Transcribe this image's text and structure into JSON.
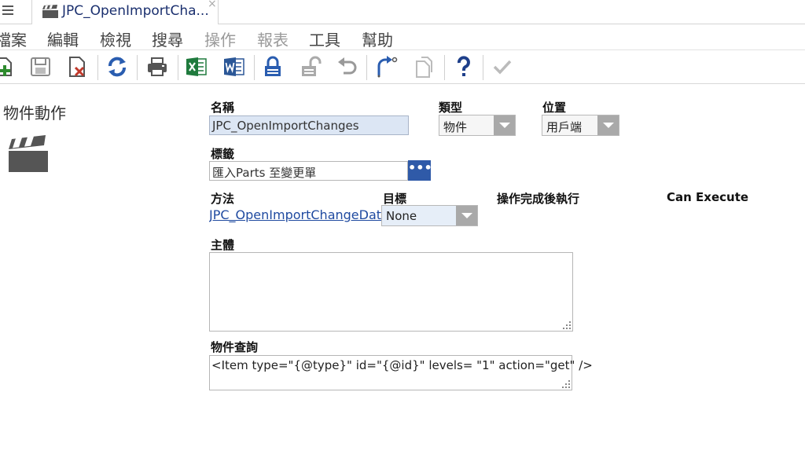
{
  "tab": {
    "title": "JPC_OpenImportCha...",
    "close_glyph": "×",
    "icon": "clapperboard-icon"
  },
  "menu": [
    {
      "label": "檔案",
      "enabled": true
    },
    {
      "label": "編輯",
      "enabled": true
    },
    {
      "label": "檢視",
      "enabled": true
    },
    {
      "label": "搜尋",
      "enabled": true
    },
    {
      "label": "操作",
      "enabled": false
    },
    {
      "label": "報表",
      "enabled": false
    },
    {
      "label": "工具",
      "enabled": true
    },
    {
      "label": "幫助",
      "enabled": true
    }
  ],
  "toolbar": {
    "icons": [
      "new-icon",
      "save-icon",
      "discard-icon",
      "refresh-icon",
      "print-icon",
      "excel-icon",
      "word-icon",
      "lock-icon",
      "unlock-icon",
      "undo-icon",
      "promote-icon",
      "copy-icon",
      "help-icon",
      "done-icon"
    ]
  },
  "left": {
    "title": "物件動作",
    "icon": "clapperboard-icon"
  },
  "form": {
    "name_label": "名稱",
    "name_value": "JPC_OpenImportChanges",
    "type_label": "類型",
    "type_value": "物件",
    "location_label": "位置",
    "location_value": "用戶端",
    "label_label": "標籤",
    "label_value": "匯入Parts 至變更單",
    "label_button": "•••",
    "method_label": "方法",
    "method_value": "JPC_OpenImportChangeData",
    "target_label": "目標",
    "target_value": "None",
    "on_complete_label": "操作完成後執行",
    "can_execute_label": "Can Execute",
    "body_label": "主體",
    "body_value": "",
    "query_label": "物件查詢",
    "query_value": "<Item type=\"{@type}\" id=\"{@id}\" levels= \"1\" action=\"get\" />"
  },
  "colors": {
    "accent": "#2f5aa8",
    "input_bg": "#dce6f4",
    "link": "#1f4aa0",
    "tab_text": "#1a2f6e"
  }
}
